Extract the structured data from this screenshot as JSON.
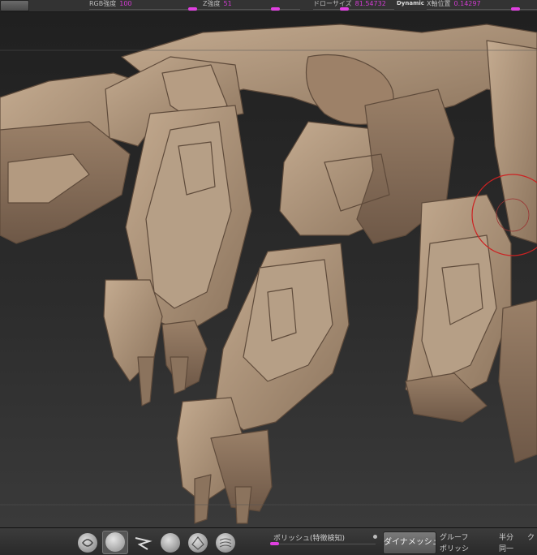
{
  "top_bar": {
    "rgb_intensity": {
      "label": "RGB強度",
      "value": "100"
    },
    "z_intensity": {
      "label": "Z強度",
      "value": "51"
    },
    "draw_size": {
      "label": "ドローサイズ",
      "value": "81.54732"
    },
    "dynamic": {
      "label": "Dynamic"
    },
    "x_position": {
      "label": "X軸位置",
      "value": "0.14297"
    }
  },
  "shelf": {
    "polish_label": "ポリッシュ(特徴検知)",
    "dynamesh_label": "ダイナメッシュ",
    "group_label": "グルーフ",
    "polish2_label": "ポリッシ",
    "half_label": "半分",
    "same_label": "同一",
    "edge_label": "ク"
  },
  "colors": {
    "accent": "#e040e0",
    "model": "#a88f76",
    "brush_circle": "#cc2222"
  },
  "icons": [
    "current-brush-icon",
    "move-brush-icon",
    "snake-hook-icon",
    "standard-brush-icon",
    "clay-buildup-icon",
    "hpolish-brush-icon"
  ]
}
